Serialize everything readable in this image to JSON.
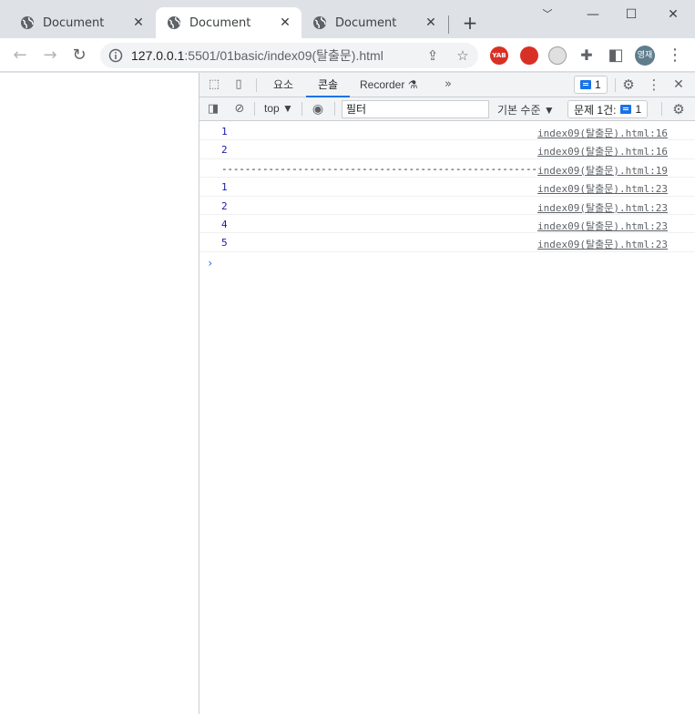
{
  "tabs": [
    {
      "title": "Document",
      "active": false
    },
    {
      "title": "Document",
      "active": true
    },
    {
      "title": "Document",
      "active": false
    }
  ],
  "toolbar": {
    "url_host": "127.0.0.1",
    "url_rest": ":5501/01basic/index09(탈출문).html",
    "profile_label": "영재"
  },
  "devtools": {
    "tabs": [
      "요소",
      "콘솔",
      "Recorder"
    ],
    "active_tab": "콘솔",
    "issues_badge_count": "1",
    "context": "top ▼",
    "filter_placeholder": "필터",
    "levels": "기본 수준 ▼",
    "issues_label": "문제 1건:",
    "issues_count": "1"
  },
  "console": {
    "rows": [
      {
        "message": "1",
        "source": "index09(탈출문).html:16"
      },
      {
        "message": "2",
        "source": "index09(탈출문).html:16"
      },
      {
        "message": "------------------------------------------------------",
        "source": "index09(탈출문).html:19"
      },
      {
        "message": "1",
        "source": "index09(탈출문).html:23"
      },
      {
        "message": "2",
        "source": "index09(탈출문).html:23"
      },
      {
        "message": "4",
        "source": "index09(탈출문).html:23"
      },
      {
        "message": "5",
        "source": "index09(탈출문).html:23"
      }
    ],
    "prompt": "›"
  },
  "colors": {
    "accent": "#1a73e8",
    "number": "#1a1aa6",
    "tabstrip": "#dee1e6"
  }
}
